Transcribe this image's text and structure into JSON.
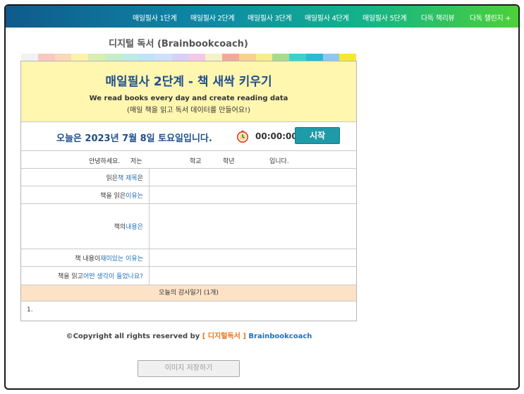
{
  "nav": {
    "items": [
      "매일필사 1단계",
      "매일필사 2단계",
      "매일필사 3단계",
      "매일필사 4단계",
      "매일필사 5단계",
      "다독 책리뷰",
      "다독 챌린지 +"
    ]
  },
  "brand": "디지털 독서 (Brainbookcoach)",
  "palette": [
    "#f2f2f2",
    "#f9c8c0",
    "#fbd9b8",
    "#fdf2a8",
    "#d9efb0",
    "#c5eec8",
    "#bdece6",
    "#bfe4f5",
    "#cfe0fb",
    "#d9d0f7",
    "#f5c8e6",
    "#f3f3c8",
    "#f4a89a",
    "#f9d08f",
    "#f6ee86",
    "#a8dc8c",
    "#3cd2cb",
    "#2eb7d6",
    "#8ec7ef",
    "#f6e832"
  ],
  "hero": {
    "title": "매일필사 2단계 - 책 새싹 키우기",
    "sub1": "We read books every day and create reading data",
    "sub2": "(매일 책을 읽고 독서 데이터를 만들어요!)"
  },
  "daterow": {
    "date": "오늘은 2023년 7월 8일 토요일입니다.",
    "clock_icon": "stopwatch-icon",
    "timer": "00:00:00",
    "start": "시작"
  },
  "greeting": {
    "hello": "안녕하세요.",
    "iam": "저는",
    "school": "학교",
    "grade": "학년",
    "end": "입니다."
  },
  "rows": [
    {
      "pre": "읽은 ",
      "hl": "책 제목",
      "post": "은"
    },
    {
      "pre": "책을 읽은 ",
      "hl": "이유는",
      "post": ""
    },
    {
      "pre": "책의 ",
      "hl": "내용은",
      "post": ""
    },
    {
      "pre": "책 내용이 ",
      "hl": "재미있는 이유는",
      "post": ""
    },
    {
      "pre": "책을 읽고 ",
      "hl": "어떤 생각이 들었나요?",
      "post": ""
    }
  ],
  "gratitude": {
    "heading": "오늘의 감사일기 (1개)",
    "item": "1."
  },
  "copyright": {
    "pre": "©Copyright all rights reserved by ",
    "mid": "[ 디지털독서 ]",
    "post": " Brainbookcoach"
  },
  "save_button": "이미지 저장하기"
}
